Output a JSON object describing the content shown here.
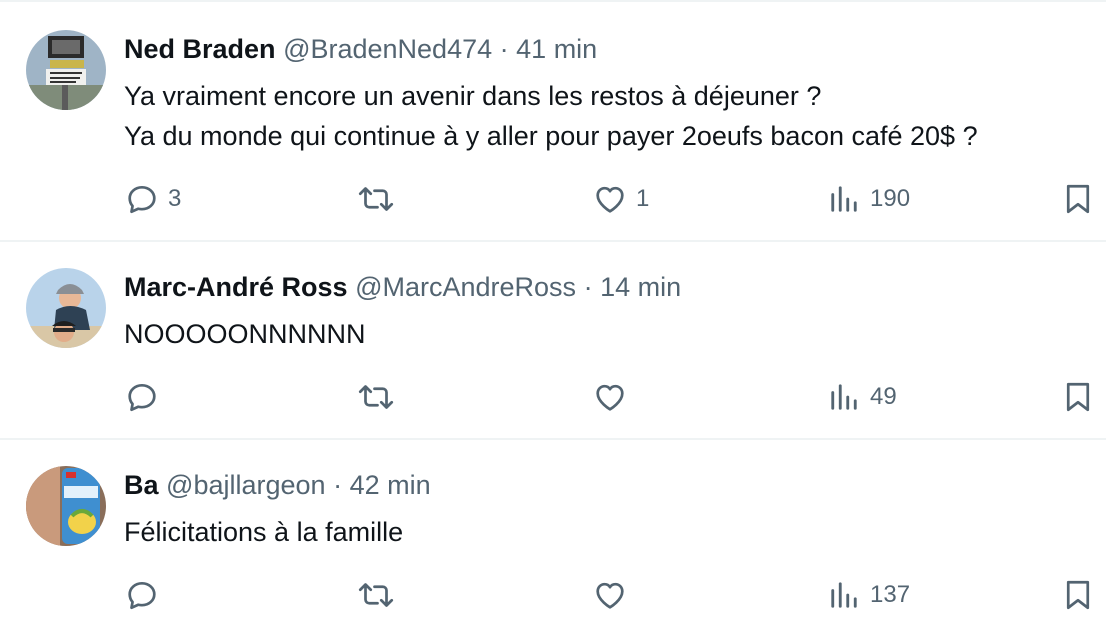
{
  "tweets": [
    {
      "name": "Ned Braden",
      "handle": "@BradenNed474",
      "separator": "·",
      "time": "41 min",
      "lines": [
        "Ya vraiment encore un avenir dans les restos à déjeuner ?",
        "Ya du monde qui continue à y aller pour payer 2oeufs bacon café 20$ ?"
      ],
      "replies": "3",
      "retweets": "",
      "likes": "1",
      "views": "190"
    },
    {
      "name": "Marc-André Ross",
      "handle": "@MarcAndreRoss",
      "separator": "·",
      "time": "14 min",
      "lines": [
        "NOOOOONNNNNN"
      ],
      "replies": "",
      "retweets": "",
      "likes": "",
      "views": "49"
    },
    {
      "name": "Ba",
      "handle": "@bajllargeon",
      "separator": "·",
      "time": "42 min",
      "lines": [
        "Félicitations à la famille"
      ],
      "replies": "",
      "retweets": "",
      "likes": "",
      "views": "137"
    }
  ],
  "icons": {
    "reply": "reply-icon",
    "retweet": "retweet-icon",
    "like": "heart-icon",
    "views": "views-icon",
    "bookmark": "bookmark-icon"
  },
  "colors": {
    "text": "#0f1419",
    "secondary": "#536471",
    "divider": "#eff3f4"
  }
}
